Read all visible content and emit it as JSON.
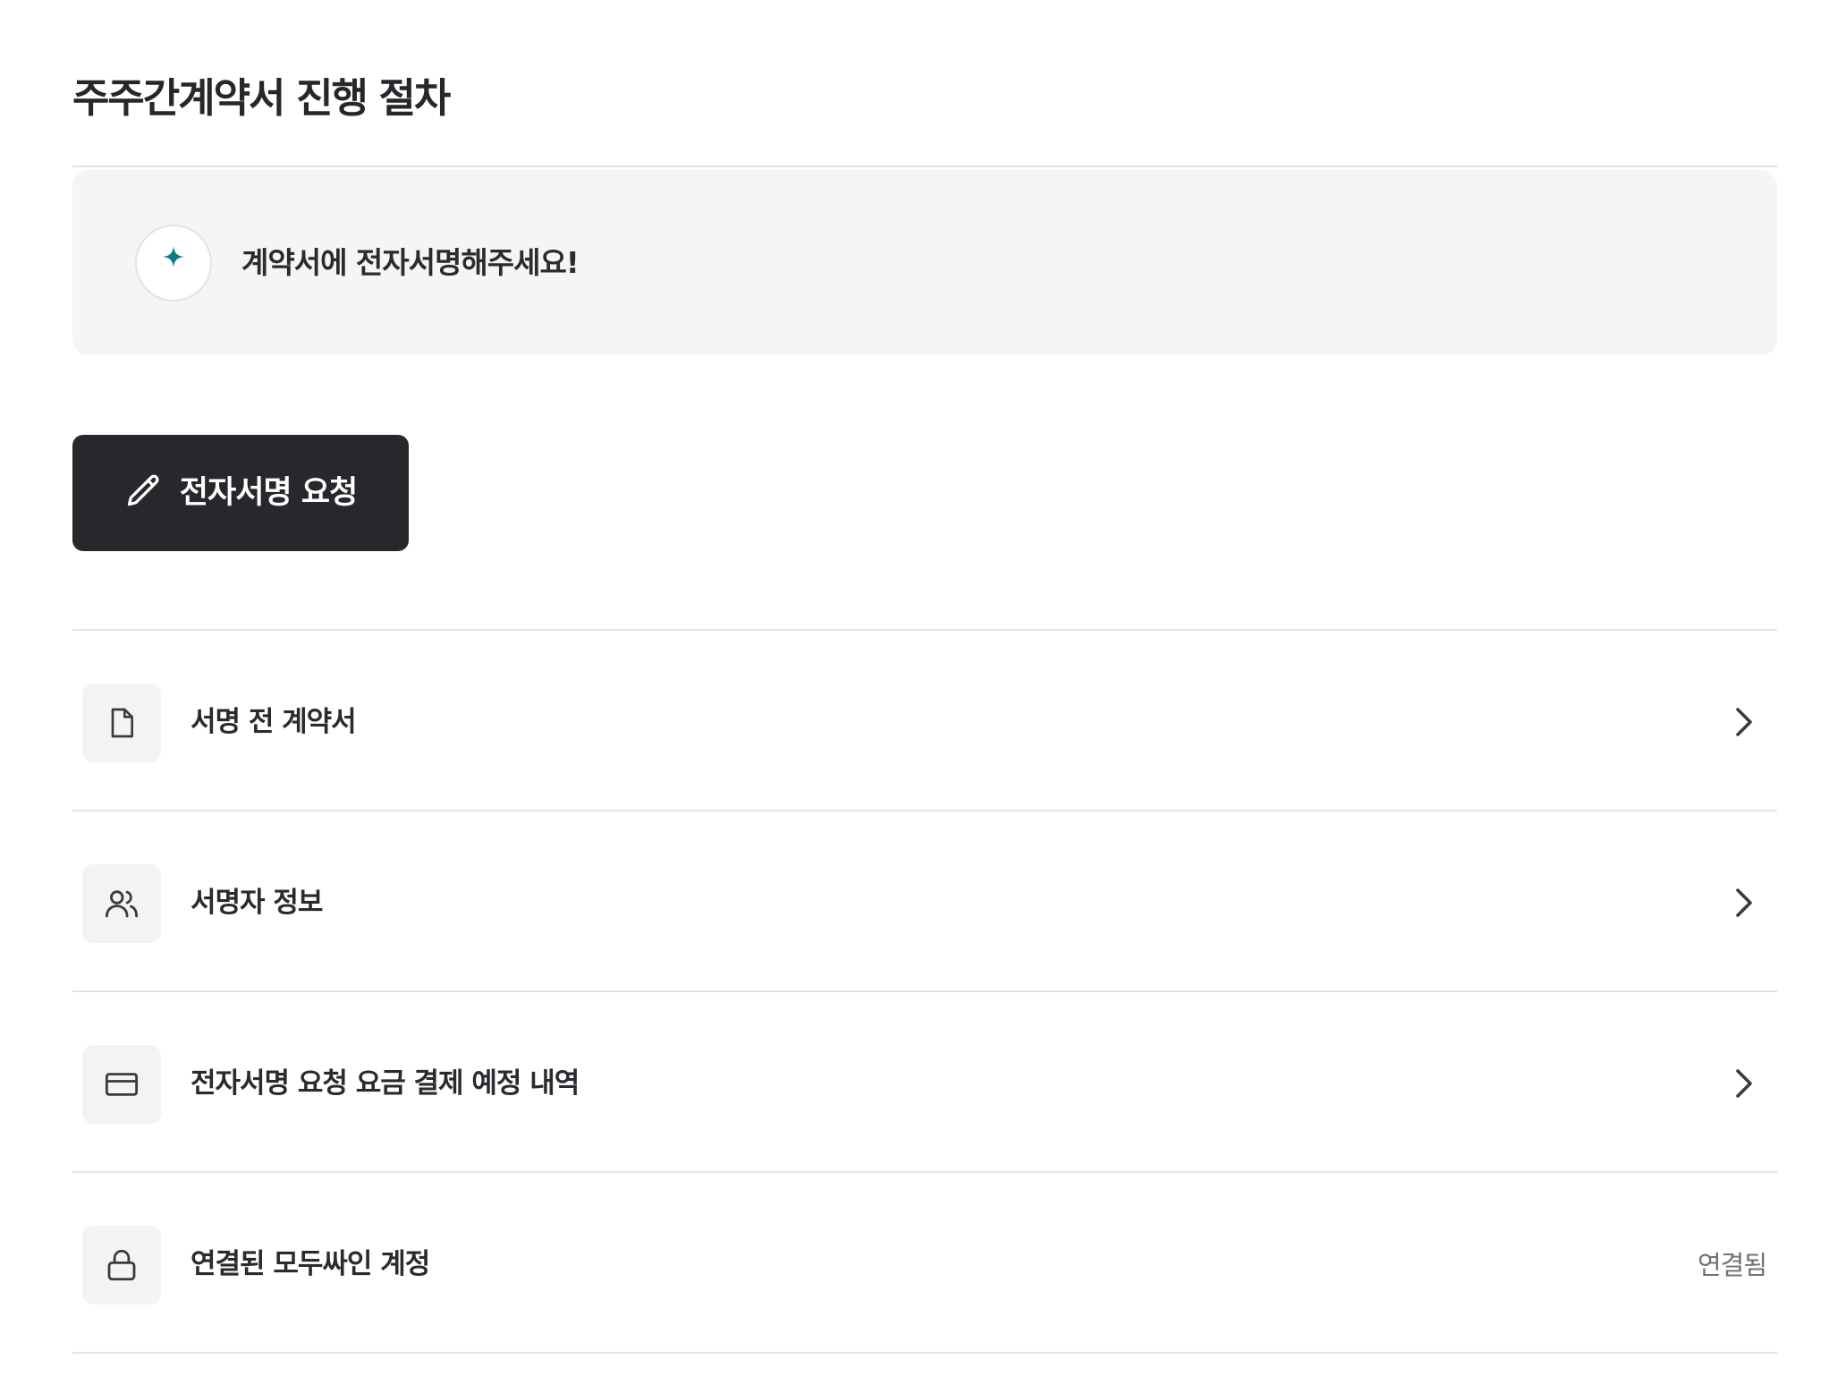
{
  "header": {
    "title": "주주간계약서 진행 절차"
  },
  "notice": {
    "icon": "sparkle-icon",
    "accent_color": "#0e7c86",
    "text": "계약서에 전자서명해주세요!"
  },
  "primary_action": {
    "icon": "pencil-icon",
    "label": "전자서명 요청"
  },
  "items": [
    {
      "icon": "document-icon",
      "label": "서명 전 계약서",
      "trailing": "chevron-right-icon"
    },
    {
      "icon": "users-icon",
      "label": "서명자 정보",
      "trailing": "chevron-right-icon"
    },
    {
      "icon": "credit-card-icon",
      "label": "전자서명 요청 요금 결제 예정 내역",
      "trailing": "chevron-right-icon"
    },
    {
      "icon": "lock-icon",
      "label": "연결된 모두싸인 계정",
      "status": "연결됨"
    }
  ]
}
